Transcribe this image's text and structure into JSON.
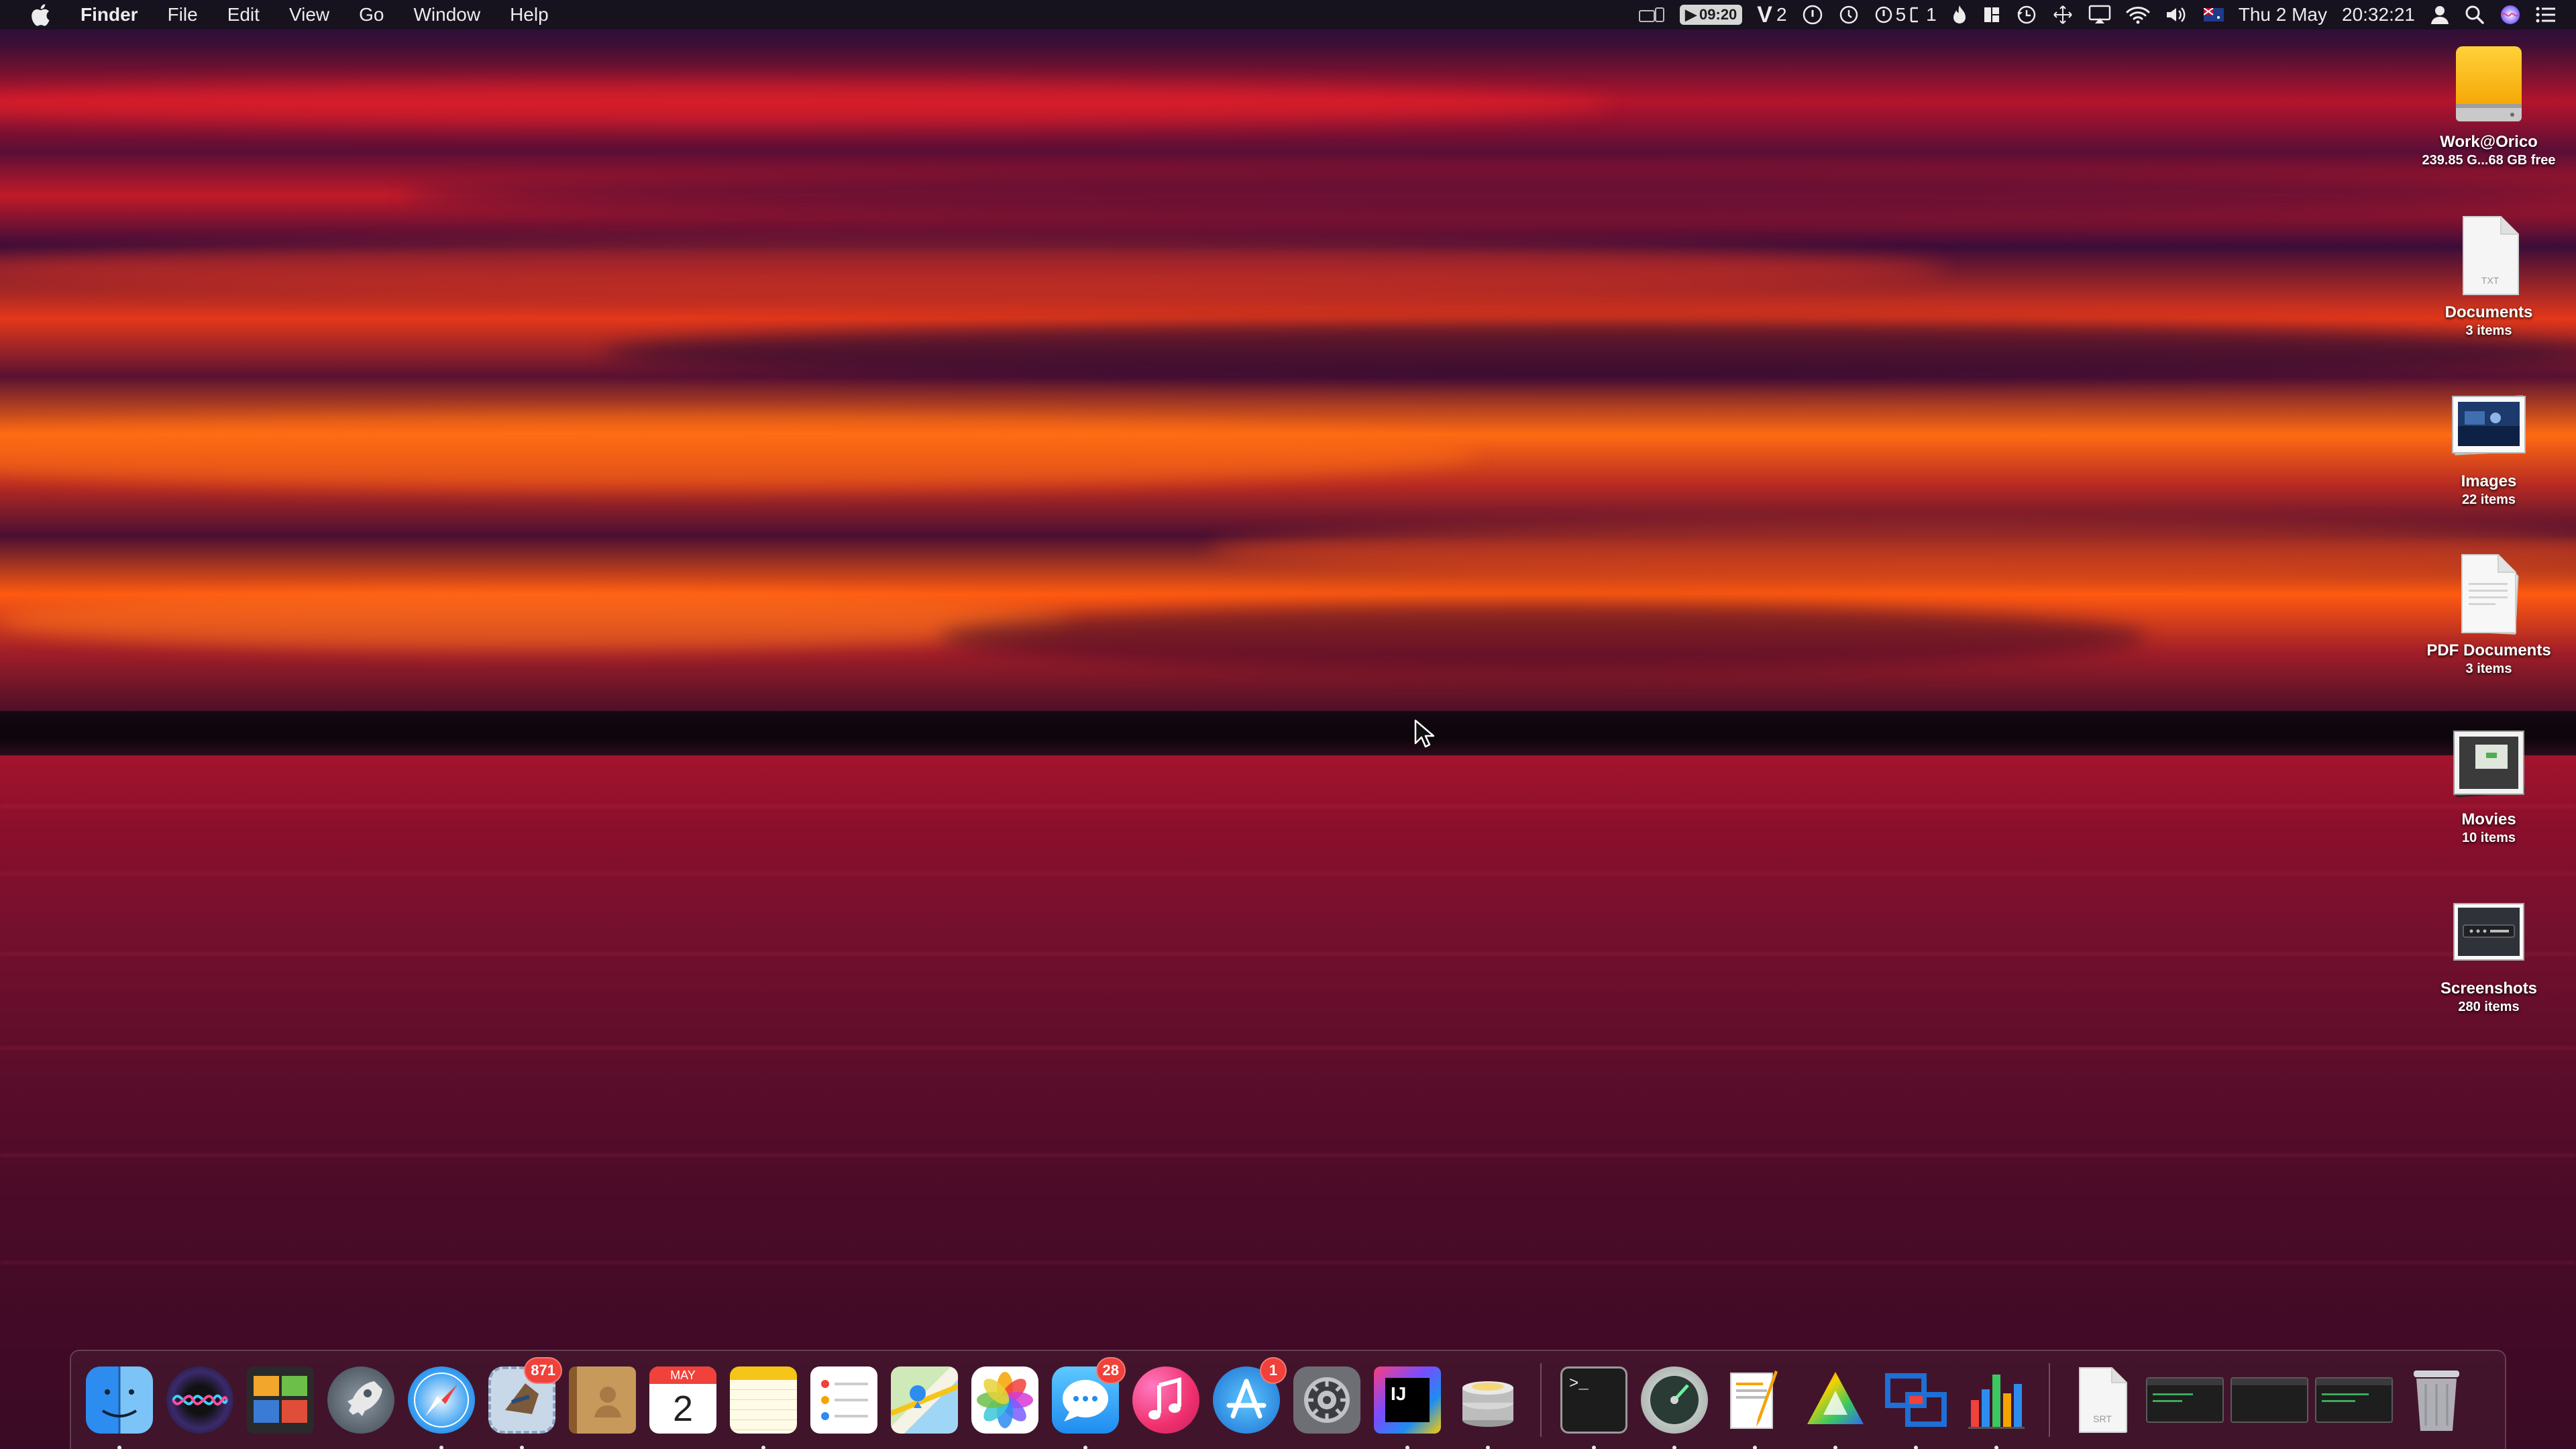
{
  "menubar": {
    "apple_icon": "apple-logo-icon",
    "app_name": "Finder",
    "menus": [
      "File",
      "Edit",
      "View",
      "Go",
      "Window",
      "Help"
    ],
    "status": {
      "timer": "09:20",
      "v_count": "2",
      "counter_text": "5",
      "counter_text2": "1",
      "date": "Thu 2 May",
      "time": "20:32:21"
    }
  },
  "desktop": {
    "items": [
      {
        "name": "Work@Orico",
        "sub": "239.85 G...68 GB free",
        "icon": "external-drive-icon"
      },
      {
        "name": "Documents",
        "sub": "3 items",
        "icon": "text-document-icon"
      },
      {
        "name": "Images",
        "sub": "22 items",
        "icon": "image-stack-icon"
      },
      {
        "name": "PDF Documents",
        "sub": "3 items",
        "icon": "pdf-document-icon"
      },
      {
        "name": "Movies",
        "sub": "10 items",
        "icon": "movie-stack-icon"
      },
      {
        "name": "Screenshots",
        "sub": "280 items",
        "icon": "screenshot-stack-icon"
      }
    ]
  },
  "dock": {
    "calendar_month": "MAY",
    "calendar_day": "2",
    "mail_badge": "871",
    "messages_badge": "28",
    "appstore_badge": "1",
    "intellij_label": "IJ",
    "terminal_prompt": ">_",
    "srt_label": "SRT"
  },
  "colors": {
    "menubar_bg": "#16121c",
    "badge_red": "#f0413a",
    "drive_yellow": "#f5b700"
  }
}
